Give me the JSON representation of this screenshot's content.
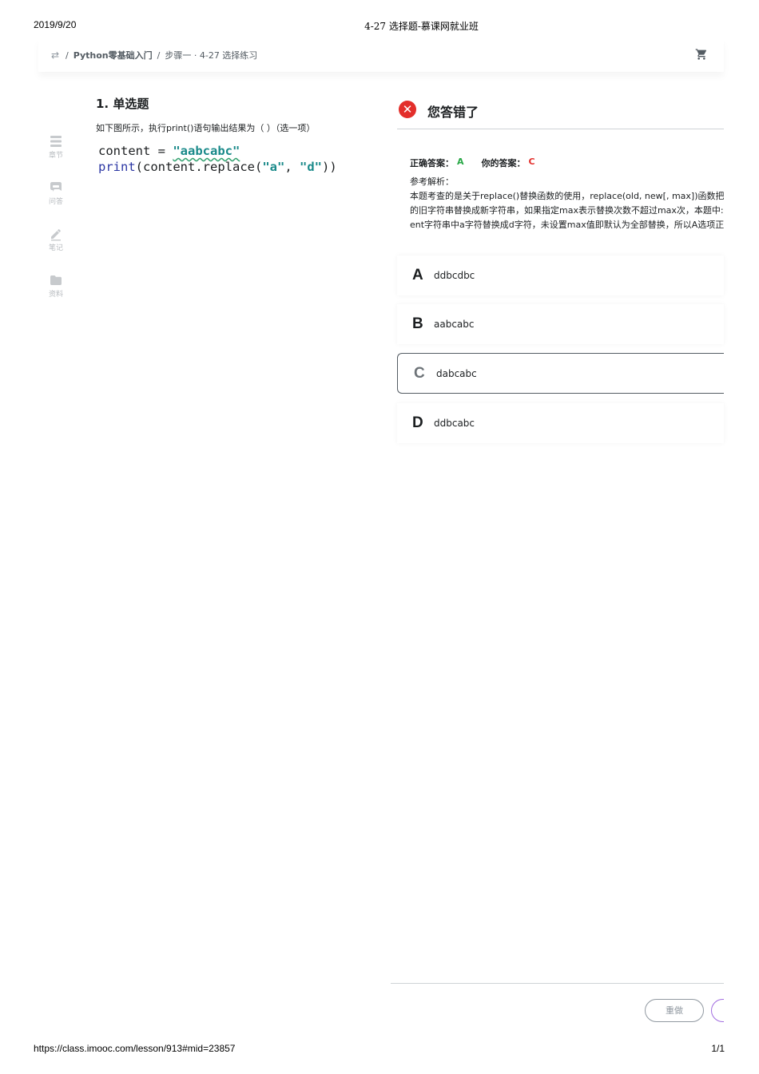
{
  "print": {
    "date": "2019/9/20",
    "title": "4-27 选择题-慕课网就业班",
    "url": "https://class.imooc.com/lesson/913#mid=23857",
    "page": "1/1"
  },
  "breadcrumb": {
    "sep": "/",
    "course": "Python零基础入门",
    "step": "步骤一 · 4-27 选择练习"
  },
  "sidenav": [
    {
      "label": "章节",
      "icon": "chapter-icon"
    },
    {
      "label": "问答",
      "icon": "qa-icon"
    },
    {
      "label": "笔记",
      "icon": "note-icon"
    },
    {
      "label": "资料",
      "icon": "folder-icon"
    }
  ],
  "question": {
    "title": "1. 单选题",
    "text": "如下图所示，执行print()语句输出结果为（ ）（选一项）",
    "code": {
      "line1_var": "content",
      "line1_eq": " = ",
      "line1_str": "\"aabcabc\"",
      "line2_fn": "print",
      "line2_mid": "(content.replace(",
      "line2_arg1": "\"a\"",
      "line2_comma": ", ",
      "line2_arg2": "\"d\"",
      "line2_end": "))"
    }
  },
  "result": {
    "status_text": "您答错了",
    "status_color": "#e32f2b",
    "correct_label": "正确答案：",
    "correct_value": "A",
    "yours_label": "你的答案：",
    "yours_value": "C",
    "analysis_label": "参考解析：",
    "analysis_lines": [
      "本题考查的是关于replace()替换函数的使用，replace(old, new[, max])函数把字",
      "的旧字符串替换成新字符串，如果指定max表示替换次数不超过max次，本题中:",
      "ent字符串中a字符替换成d字符，未设置max值即默认为全部替换，所以A选项正"
    ]
  },
  "options": [
    {
      "letter": "A",
      "text": "ddbcdbc"
    },
    {
      "letter": "B",
      "text": "aabcabc"
    },
    {
      "letter": "C",
      "text": "dabcabc",
      "selected": true
    },
    {
      "letter": "D",
      "text": "ddbcabc"
    }
  ],
  "actions": {
    "redo_label": "重做"
  }
}
